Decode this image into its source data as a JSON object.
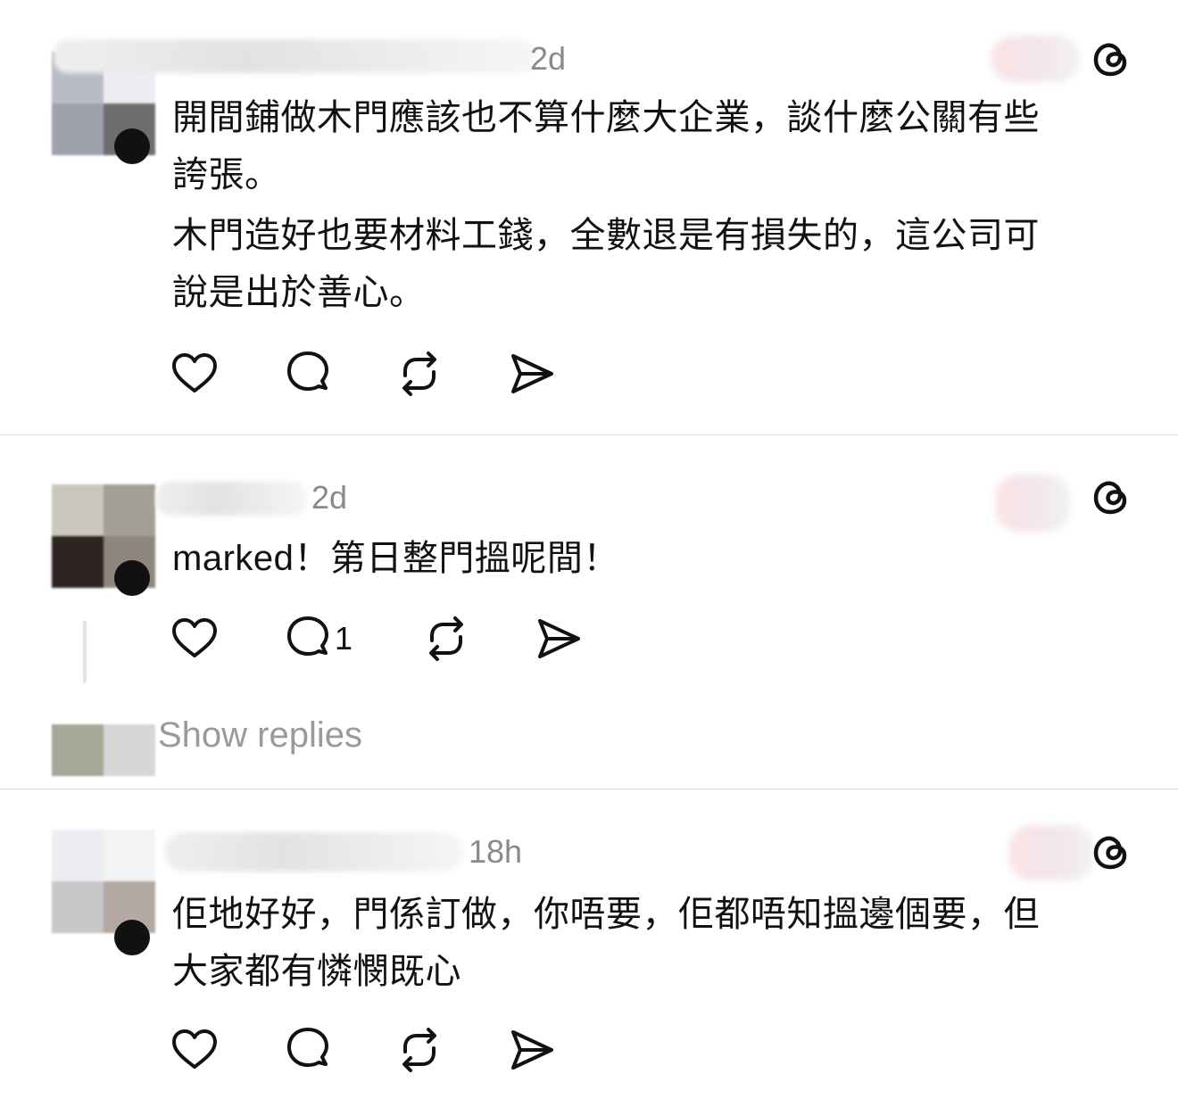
{
  "posts": [
    {
      "time": "2d",
      "paragraphs": [
        "開間鋪做木門應該也不算什麼大企業，談什麼公關有些\n誇張。",
        "木門造好也要材料工錢，全數退是有損失的，這公司可\n說是出於善心。"
      ],
      "reply_count": ""
    },
    {
      "time": "2d",
      "paragraphs": [
        "marked！第日整門搵呢間！"
      ],
      "reply_count": "1"
    },
    {
      "time": "18h",
      "paragraphs": [
        "佢地好好，門係訂做，你唔要，佢都唔知搵邊個要，但\n大家都有憐憫既心"
      ],
      "reply_count": ""
    }
  ],
  "show_replies_label": "Show replies",
  "icons": {
    "like": "heart-icon",
    "comment": "comment-bubble-icon",
    "repost": "repost-icon",
    "share": "send-icon",
    "brand": "threads-logo-icon"
  },
  "colors": {
    "text": "#111111",
    "muted": "#8a8a8a",
    "divider": "#dcdcdc"
  }
}
